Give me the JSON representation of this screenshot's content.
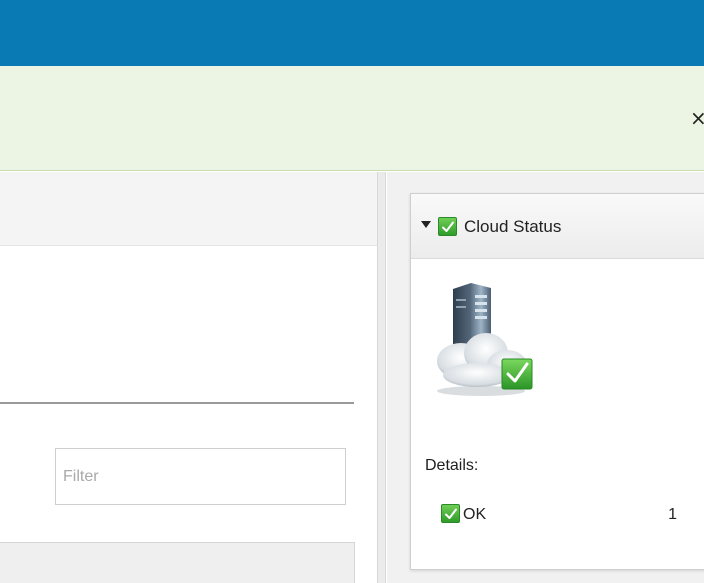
{
  "notice": {
    "close_glyph": "×"
  },
  "left": {
    "filter_placeholder": "Filter",
    "filter_value": ""
  },
  "widget": {
    "title": "Cloud Status",
    "status_icon": "check-icon",
    "details_label": "Details:",
    "rows": [
      {
        "label": "OK",
        "count": "1",
        "icon": "check-icon"
      }
    ]
  },
  "colors": {
    "topbar": "#0a7ab4",
    "notice_bg": "#ecf5e3",
    "ok_green": "#3aa832"
  }
}
